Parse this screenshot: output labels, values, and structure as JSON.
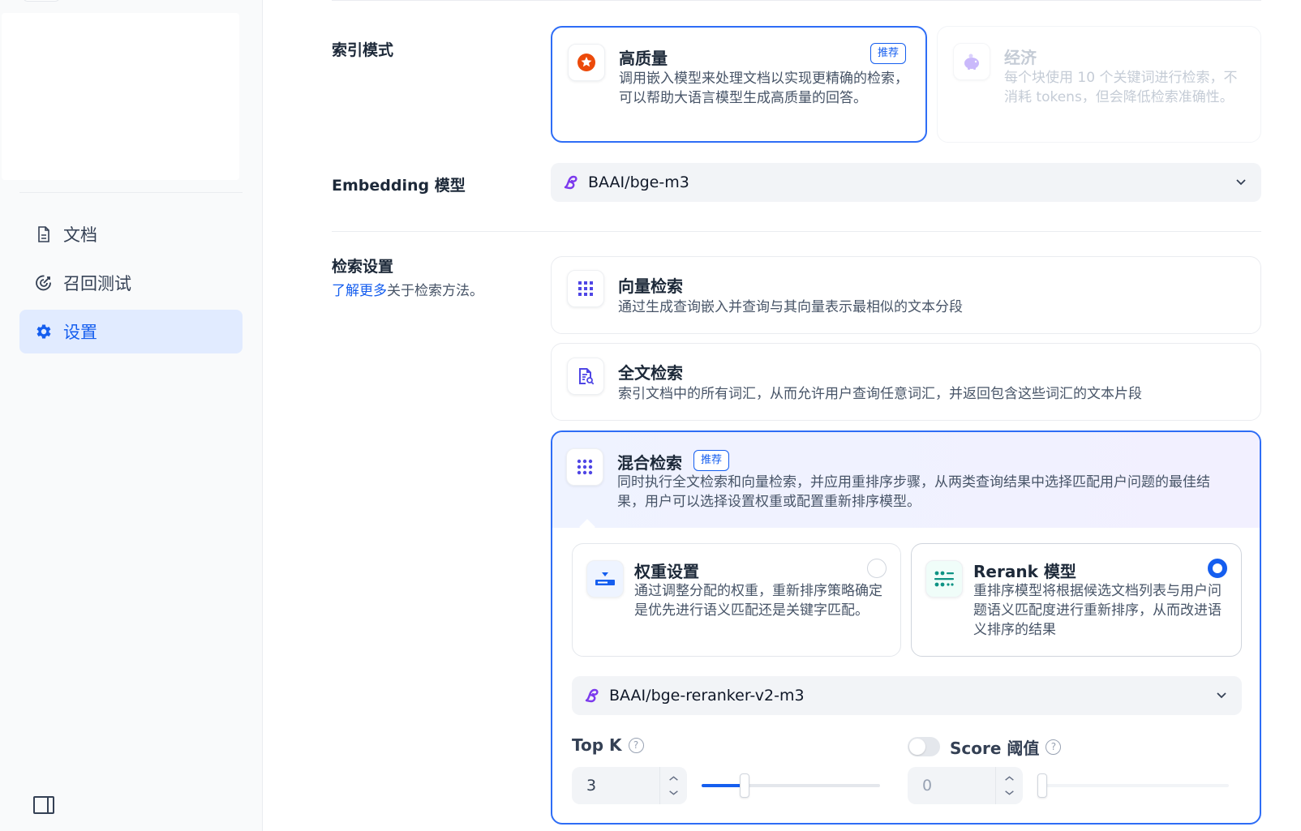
{
  "sidebar": {
    "items": [
      {
        "label": "文档",
        "icon": "document-icon"
      },
      {
        "label": "召回测试",
        "icon": "target-icon"
      },
      {
        "label": "设置",
        "icon": "gear-icon"
      }
    ]
  },
  "index_mode": {
    "label": "索引模式",
    "high_quality": {
      "title": "高质量",
      "badge": "推荐",
      "desc": "调用嵌入模型来处理文档以实现更精确的检索，可以帮助大语言模型生成高质量的回答。"
    },
    "economy": {
      "title": "经济",
      "desc": "每个块使用 10 个关键词进行检索，不消耗 tokens，但会降低检索准确性。"
    }
  },
  "embedding": {
    "label": "Embedding 模型",
    "value": "BAAI/bge-m3"
  },
  "retrieval": {
    "label": "检索设置",
    "learn_more": "了解更多",
    "desc_suffix": "关于检索方法。",
    "vector": {
      "title": "向量检索",
      "desc": "通过生成查询嵌入并查询与其向量表示最相似的文本分段"
    },
    "fulltext": {
      "title": "全文检索",
      "desc": "索引文档中的所有词汇，从而允许用户查询任意词汇，并返回包含这些词汇的文本片段"
    },
    "hybrid": {
      "title": "混合检索",
      "badge": "推荐",
      "desc": "同时执行全文检索和向量检索，并应用重排序步骤，从两类查询结果中选择匹配用户问题的最佳结果，用户可以选择设置权重或配置重新排序模型。",
      "weight": {
        "title": "权重设置",
        "desc": "通过调整分配的权重，重新排序策略确定是优先进行语义匹配还是关键字匹配。"
      },
      "rerank": {
        "title": "Rerank 模型",
        "desc": "重排序模型将根据候选文档列表与用户问题语义匹配度进行重新排序，从而改进语义排序的结果"
      },
      "rerank_model": "BAAI/bge-reranker-v2-m3",
      "top_k": {
        "label": "Top K",
        "value": "3",
        "fraction": 0.24
      },
      "score": {
        "label": "Score 阈值",
        "value": "0",
        "fraction": 0.0,
        "enabled": false
      }
    }
  },
  "colors": {
    "accent": "#155eef",
    "selected_border": "#2e6df6"
  }
}
